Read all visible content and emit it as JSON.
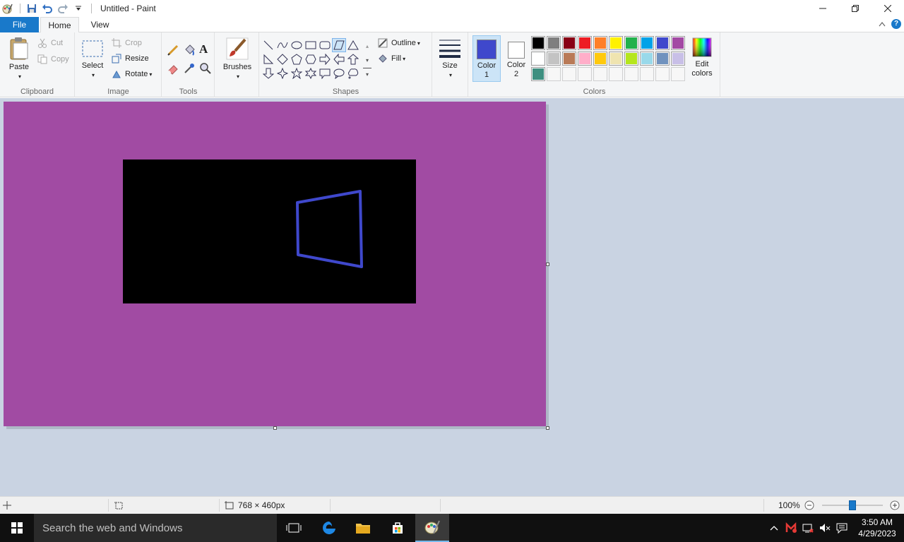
{
  "window": {
    "title": "Untitled - Paint"
  },
  "tabs": {
    "file": "File",
    "home": "Home",
    "view": "View"
  },
  "ribbon": {
    "clipboard": {
      "paste": "Paste",
      "cut": "Cut",
      "copy": "Copy",
      "label": "Clipboard"
    },
    "image": {
      "select": "Select",
      "crop": "Crop",
      "resize": "Resize",
      "rotate": "Rotate",
      "label": "Image"
    },
    "tools": {
      "label": "Tools"
    },
    "brushes": {
      "label": "Brushes"
    },
    "shapes": {
      "outline": "Outline",
      "fill": "Fill",
      "label": "Shapes"
    },
    "size": {
      "label": "Size"
    },
    "colors": {
      "color1_label": "Color",
      "color1_num": "1",
      "color2_label": "Color",
      "color2_num": "2",
      "edit_label1": "Edit",
      "edit_label2": "colors",
      "label": "Colors",
      "color1": "#3f48cc",
      "color2": "#ffffff",
      "palette": [
        "#000000",
        "#7f7f7f",
        "#880015",
        "#ed1c24",
        "#ff7f27",
        "#fff200",
        "#22b14c",
        "#00a2e8",
        "#3f48cc",
        "#a349a4",
        "#ffffff",
        "#c3c3c3",
        "#b97a57",
        "#ffaec9",
        "#ffc90e",
        "#efe4b0",
        "#b5e61d",
        "#99d9ea",
        "#7092be",
        "#c8bfe7",
        "#3e8f80",
        "#ffffff",
        "#ffffff",
        "#ffffff",
        "#ffffff",
        "#ffffff",
        "#ffffff",
        "#ffffff",
        "#ffffff",
        "#ffffff"
      ]
    }
  },
  "canvas": {
    "background": "#a14ba3",
    "inner_rect": "#000000",
    "stroke": "#3f48cc"
  },
  "status": {
    "dimensions": "768 × 460px",
    "zoom": "100%",
    "zoom_level": 0.5
  },
  "taskbar": {
    "search_placeholder": "Search the web and Windows",
    "time": "3:50 AM",
    "date": "4/29/2023"
  }
}
